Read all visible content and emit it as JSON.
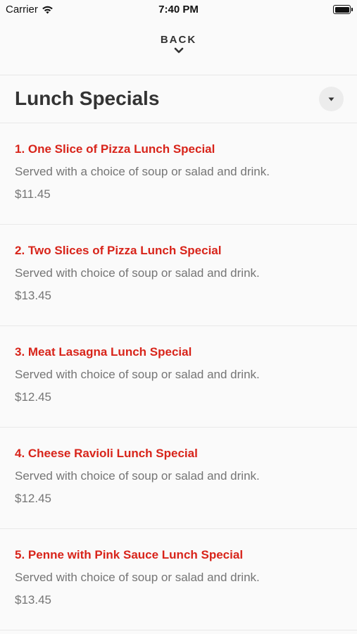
{
  "status_bar": {
    "carrier": "Carrier",
    "time": "7:40 PM"
  },
  "nav": {
    "back_label": "BACK"
  },
  "section": {
    "title": "Lunch Specials"
  },
  "colors": {
    "accent": "#d8241a",
    "text_secondary": "#757575",
    "background": "#fafafa"
  },
  "icons": [
    "wifi-icon",
    "battery-icon",
    "chevron-down-icon",
    "caret-down-icon"
  ],
  "items": [
    {
      "name": "1. One Slice of Pizza Lunch Special",
      "description": "Served with a choice of soup or salad and drink.",
      "price": "$11.45"
    },
    {
      "name": "2. Two Slices of Pizza Lunch Special",
      "description": "Served with choice of soup or salad and drink.",
      "price": "$13.45"
    },
    {
      "name": "3. Meat Lasagna Lunch Special",
      "description": "Served with choice of soup or salad and drink.",
      "price": "$12.45"
    },
    {
      "name": "4. Cheese Ravioli Lunch Special",
      "description": "Served with choice of soup or salad and drink.",
      "price": "$12.45"
    },
    {
      "name": "5. Penne with Pink Sauce Lunch Special",
      "description": "Served with choice of soup or salad and drink.",
      "price": "$13.45"
    }
  ]
}
